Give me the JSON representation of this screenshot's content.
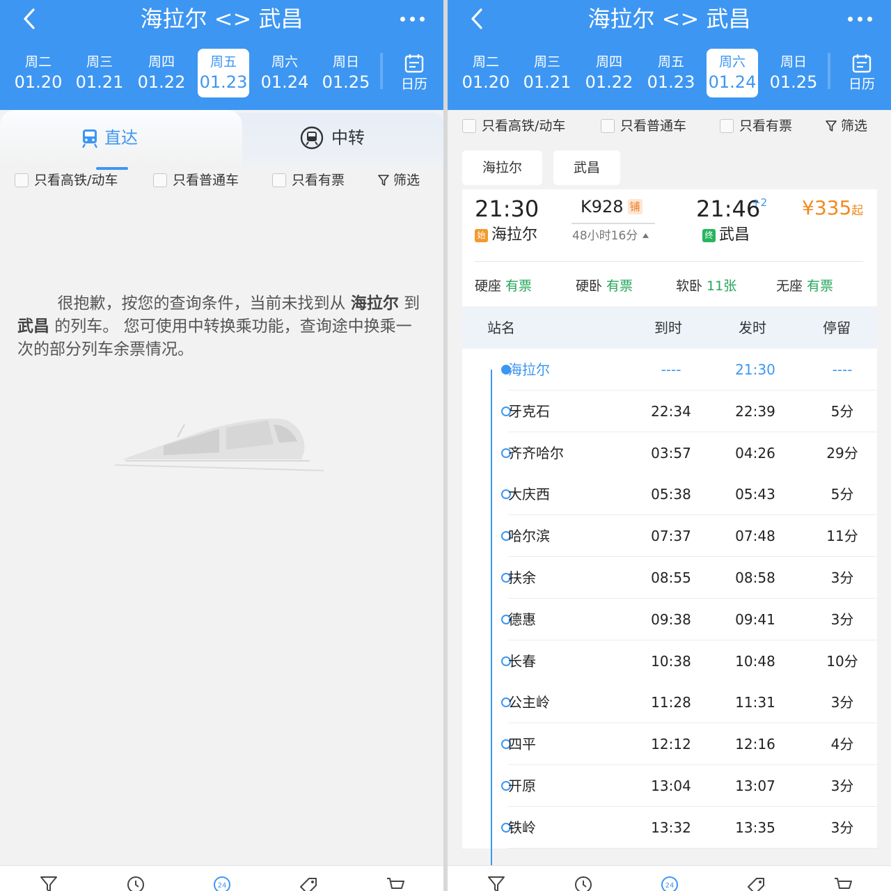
{
  "left": {
    "title": "海拉尔 <> 武昌",
    "dates": [
      {
        "week": "周二",
        "date": "01.20"
      },
      {
        "week": "周三",
        "date": "01.21"
      },
      {
        "week": "周四",
        "date": "01.22"
      },
      {
        "week": "周五",
        "date": "01.23",
        "selected": true
      },
      {
        "week": "周六",
        "date": "01.24"
      },
      {
        "week": "周日",
        "date": "01.25"
      }
    ],
    "calendar_label": "日历",
    "tab_direct": "直达",
    "tab_transfer": "中转",
    "filters": {
      "highspeed": "只看高铁/动车",
      "normal": "只看普通车",
      "available": "只看有票",
      "screen": "筛选"
    },
    "empty_msg": {
      "p1": "很抱歉，按您的查询条件，当前未找到从 ",
      "from": "海拉尔",
      "p2": " 到 ",
      "to": "武昌",
      "p3": " 的列车。 您可使用中转换乘功能，查询途中换乘一次的部分列车余票情况。"
    }
  },
  "right": {
    "title": "海拉尔 <> 武昌",
    "dates": [
      {
        "week": "周二",
        "date": "01.20"
      },
      {
        "week": "周三",
        "date": "01.21"
      },
      {
        "week": "周四",
        "date": "01.22"
      },
      {
        "week": "周五",
        "date": "01.23"
      },
      {
        "week": "周六",
        "date": "01.24",
        "selected": true
      },
      {
        "week": "周日",
        "date": "01.25"
      }
    ],
    "calendar_label": "日历",
    "filters": {
      "highspeed": "只看高铁/动车",
      "normal": "只看普通车",
      "available": "只看有票",
      "screen": "筛选"
    },
    "station_chips": [
      "海拉尔",
      "武昌"
    ],
    "train": {
      "depart_time": "21:30",
      "depart_station": "海拉尔",
      "depart_badge": "始",
      "number": "K928",
      "sleeper_badge": "铺",
      "duration": "48小时16分",
      "arrive_time": "21:46",
      "arrive_days": "+2",
      "arrive_station": "武昌",
      "arrive_badge": "终",
      "price": "¥335",
      "price_suffix": "起"
    },
    "seats": [
      {
        "type": "硬座",
        "status": "有票"
      },
      {
        "type": "硬卧",
        "status": "有票"
      },
      {
        "type": "软卧",
        "status": "11张"
      },
      {
        "type": "无座",
        "status": "有票"
      }
    ],
    "schedule_header": {
      "name": "站名",
      "arrive": "到时",
      "depart": "发时",
      "stop": "停留"
    },
    "stops": [
      {
        "name": "海拉尔",
        "arrive": "----",
        "depart": "21:30",
        "stop": "----"
      },
      {
        "name": "牙克石",
        "arrive": "22:34",
        "depart": "22:39",
        "stop": "5分"
      },
      {
        "name": "齐齐哈尔",
        "arrive": "03:57",
        "depart": "04:26",
        "stop": "29分"
      },
      {
        "name": "大庆西",
        "arrive": "05:38",
        "depart": "05:43",
        "stop": "5分"
      },
      {
        "name": "哈尔滨",
        "arrive": "07:37",
        "depart": "07:48",
        "stop": "11分"
      },
      {
        "name": "扶余",
        "arrive": "08:55",
        "depart": "08:58",
        "stop": "3分"
      },
      {
        "name": "德惠",
        "arrive": "09:38",
        "depart": "09:41",
        "stop": "3分"
      },
      {
        "name": "长春",
        "arrive": "10:38",
        "depart": "10:48",
        "stop": "10分"
      },
      {
        "name": "公主岭",
        "arrive": "11:28",
        "depart": "11:31",
        "stop": "3分"
      },
      {
        "name": "四平",
        "arrive": "12:12",
        "depart": "12:16",
        "stop": "4分"
      },
      {
        "name": "开原",
        "arrive": "13:04",
        "depart": "13:07",
        "stop": "3分"
      },
      {
        "name": "铁岭",
        "arrive": "13:32",
        "depart": "13:35",
        "stop": "3分"
      }
    ]
  },
  "tabbar_icons": [
    "filter-icon",
    "clock-icon",
    "24h-icon",
    "tag-icon",
    "cart-icon"
  ],
  "colors": {
    "brand": "#3d96f2",
    "available": "#26a65b",
    "price": "#f08a1e"
  }
}
